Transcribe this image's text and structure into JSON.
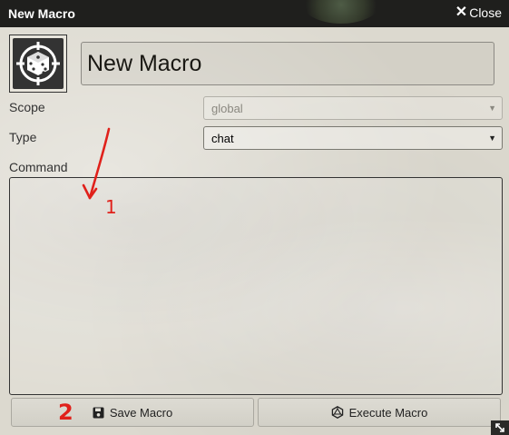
{
  "window": {
    "title": "New Macro",
    "close_label": "Close"
  },
  "macro": {
    "name": "New Macro"
  },
  "scope": {
    "label": "Scope",
    "value": "global"
  },
  "type": {
    "label": "Type",
    "value": "chat"
  },
  "command": {
    "label": "Command",
    "value": ""
  },
  "buttons": {
    "save_label": "Save Macro",
    "execute_label": "Execute Macro"
  },
  "annotations": {
    "marker_1": "1",
    "marker_2": "2",
    "color": "#e0211b"
  },
  "colors": {
    "titlebar": "#1f1f1d",
    "background": "#dcd9cf"
  }
}
